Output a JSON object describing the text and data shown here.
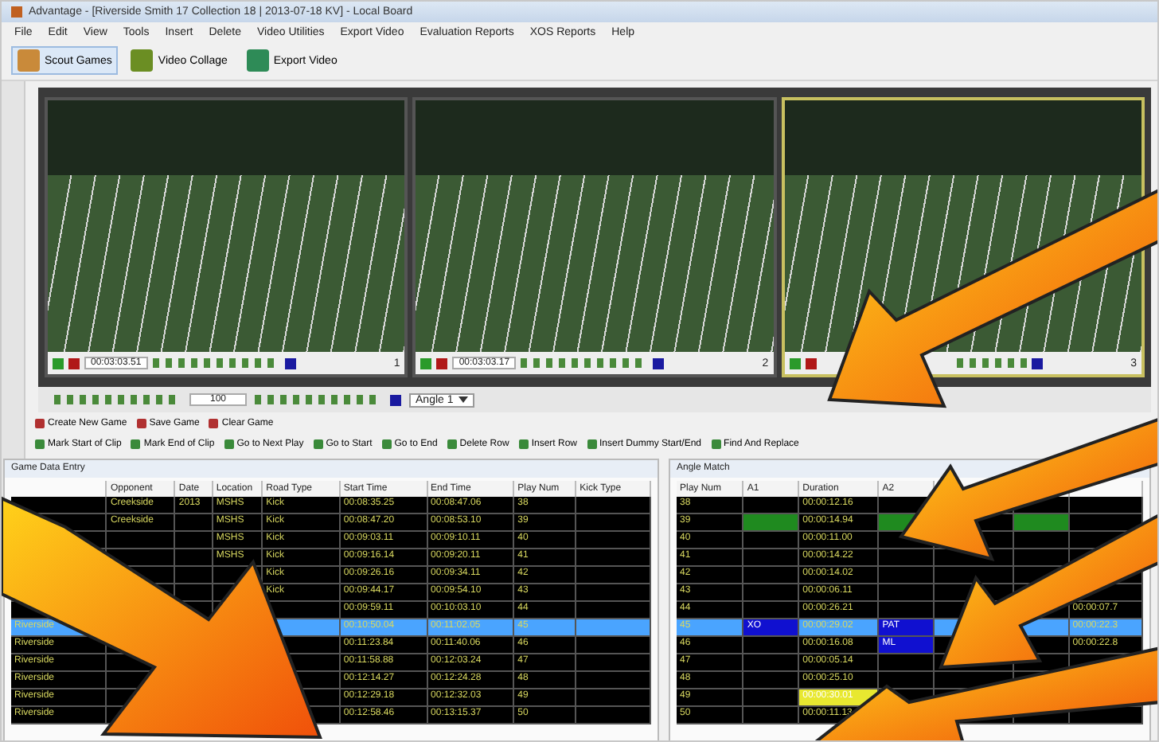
{
  "window": {
    "title": "Advantage - [Riverside Smith 17 Collection 18 | 2013-07-18 KV] - Local Board"
  },
  "menu": [
    "File",
    "Edit",
    "View",
    "Tools",
    "Insert",
    "Delete",
    "Video Utilities",
    "Export Video",
    "Evaluation Reports",
    "XOS Reports",
    "Help"
  ],
  "toolbar": [
    {
      "label": "Scout Games",
      "selected": true
    },
    {
      "label": "Video Collage",
      "selected": false
    },
    {
      "label": "Export Video",
      "selected": false
    }
  ],
  "videos": [
    {
      "timecode": "00:03:03.51",
      "angle": "1",
      "selected": false
    },
    {
      "timecode": "00:03:03.17",
      "angle": "2",
      "selected": false
    },
    {
      "angle": "3",
      "selected": true
    }
  ],
  "playback": {
    "speed": "100",
    "angle": "Angle 1"
  },
  "game_actions": [
    "Create New Game",
    "Save Game",
    "Clear Game"
  ],
  "clip_actions": [
    "Mark Start of Clip",
    "Mark End of Clip",
    "Go to Next Play",
    "Go to Start",
    "Go to End",
    "Delete Row",
    "Insert Row",
    "Insert Dummy Start/End",
    "Find And Replace"
  ],
  "game_table": {
    "title": "Game Data Entry",
    "columns": [
      {},
      {
        "label": "Opponent"
      },
      {
        "label": "Date"
      },
      {
        "label": "Location"
      },
      {
        "label": "Road Type"
      },
      {
        "label": "Start Time"
      },
      {
        "label": "End Time"
      },
      {
        "label": "Play Num"
      },
      {
        "label": "Kick Type"
      }
    ],
    "rows": [
      {
        "selected": false,
        "cells": [
          {},
          {
            "text": "Creekside"
          },
          {
            "text": "2013"
          },
          {
            "text": "MSHS"
          },
          {
            "text": "Kick"
          },
          {
            "text": "00:08:35.25"
          },
          {
            "text": "00:08:47.06"
          },
          {
            "text": "38"
          },
          {}
        ]
      },
      {
        "selected": false,
        "cells": [
          {},
          {
            "text": "Creekside"
          },
          {},
          {
            "text": "MSHS"
          },
          {
            "text": "Kick"
          },
          {
            "text": "00:08:47.20"
          },
          {
            "text": "00:08:53.10"
          },
          {
            "text": "39"
          },
          {}
        ]
      },
      {
        "selected": false,
        "cells": [
          {},
          {},
          {},
          {
            "text": "MSHS"
          },
          {
            "text": "Kick"
          },
          {
            "text": "00:09:03.11"
          },
          {
            "text": "00:09:10.11"
          },
          {
            "text": "40"
          },
          {}
        ]
      },
      {
        "selected": false,
        "cells": [
          {},
          {},
          {},
          {
            "text": "MSHS"
          },
          {
            "text": "Kick"
          },
          {
            "text": "00:09:16.14"
          },
          {
            "text": "00:09:20.11"
          },
          {
            "text": "41"
          },
          {}
        ]
      },
      {
        "selected": false,
        "cells": [
          {},
          {},
          {},
          {},
          {
            "text": "Kick"
          },
          {
            "text": "00:09:26.16"
          },
          {
            "text": "00:09:34.11"
          },
          {
            "text": "42"
          },
          {}
        ]
      },
      {
        "selected": false,
        "cells": [
          {},
          {},
          {},
          {},
          {
            "text": "Kick"
          },
          {
            "text": "00:09:44.17"
          },
          {
            "text": "00:09:54.10"
          },
          {
            "text": "43"
          },
          {}
        ]
      },
      {
        "selected": false,
        "cells": [
          {},
          {},
          {},
          {},
          {},
          {
            "text": "00:09:59.11"
          },
          {
            "text": "00:10:03.10"
          },
          {
            "text": "44"
          },
          {}
        ]
      },
      {
        "selected": true,
        "cells": [
          {
            "text": "Riverside"
          },
          {},
          {},
          {},
          {},
          {
            "text": "00:10:50.04"
          },
          {
            "text": "00:11:02.05"
          },
          {
            "text": "45"
          },
          {}
        ]
      },
      {
        "selected": false,
        "cells": [
          {
            "text": "Riverside"
          },
          {},
          {},
          {},
          {},
          {
            "text": "00:11:23.84"
          },
          {
            "text": "00:11:40.06"
          },
          {
            "text": "46"
          },
          {}
        ]
      },
      {
        "selected": false,
        "cells": [
          {
            "text": "Riverside"
          },
          {},
          {},
          {},
          {},
          {
            "text": "00:11:58.88"
          },
          {
            "text": "00:12:03.24"
          },
          {
            "text": "47"
          },
          {}
        ]
      },
      {
        "selected": false,
        "cells": [
          {
            "text": "Riverside"
          },
          {},
          {},
          {},
          {},
          {
            "text": "00:12:14.27"
          },
          {
            "text": "00:12:24.28"
          },
          {
            "text": "48"
          },
          {}
        ]
      },
      {
        "selected": false,
        "cells": [
          {
            "text": "Riverside"
          },
          {},
          {},
          {},
          {},
          {
            "text": "00:12:29.18"
          },
          {
            "text": "00:12:32.03"
          },
          {
            "text": "49"
          },
          {}
        ]
      },
      {
        "selected": false,
        "cells": [
          {
            "text": "Riverside"
          },
          {},
          {},
          {},
          {},
          {
            "text": "00:12:58.46"
          },
          {
            "text": "00:13:15.37"
          },
          {
            "text": "50"
          },
          {}
        ]
      }
    ]
  },
  "angle_table": {
    "title": "Angle Match",
    "columns": [
      {
        "label": "Play Num"
      },
      {
        "label": "A1"
      },
      {
        "label": "Duration"
      },
      {
        "label": "A2"
      },
      {},
      {},
      {}
    ],
    "rows": [
      {
        "selected": false,
        "cells": [
          {
            "text": "38"
          },
          {},
          {
            "text": "00:00:12.16"
          },
          {},
          {},
          {},
          {}
        ]
      },
      {
        "selected": false,
        "cells": [
          {
            "text": "39"
          },
          {
            "color": "#1f8a1f"
          },
          {
            "text": "00:00:14.94"
          },
          {
            "color": "#1f8a1f"
          },
          {},
          {
            "color": "#1f8a1f"
          },
          {}
        ]
      },
      {
        "selected": false,
        "cells": [
          {
            "text": "40"
          },
          {},
          {
            "text": "00:00:11.00"
          },
          {},
          {},
          {},
          {}
        ]
      },
      {
        "selected": false,
        "cells": [
          {
            "text": "41"
          },
          {},
          {
            "text": "00:00:14.22"
          },
          {},
          {},
          {},
          {}
        ]
      },
      {
        "selected": false,
        "cells": [
          {
            "text": "42"
          },
          {},
          {
            "text": "00:00:14.02"
          },
          {},
          {},
          {},
          {}
        ]
      },
      {
        "selected": false,
        "cells": [
          {
            "text": "43"
          },
          {},
          {
            "text": "00:00:06.11"
          },
          {},
          {},
          {},
          {}
        ]
      },
      {
        "selected": false,
        "cells": [
          {
            "text": "44"
          },
          {},
          {
            "text": "00:00:26.21"
          },
          {},
          {},
          {},
          {
            "text": "00:00:07.7"
          }
        ]
      },
      {
        "selected": true,
        "cells": [
          {
            "text": "45"
          },
          {
            "text": "XO",
            "color": "#1010d0"
          },
          {
            "text": "00:00:29.02"
          },
          {
            "text": "PAT",
            "color": "#1010d0"
          },
          {},
          {},
          {
            "text": "00:00:22.3"
          }
        ]
      },
      {
        "selected": false,
        "cells": [
          {
            "text": "46"
          },
          {},
          {
            "text": "00:00:16.08"
          },
          {
            "text": "ML",
            "color": "#1010d0"
          },
          {},
          {},
          {
            "text": "00:00:22.8"
          }
        ]
      },
      {
        "selected": false,
        "cells": [
          {
            "text": "47"
          },
          {},
          {
            "text": "00:00:05.14"
          },
          {},
          {},
          {},
          {}
        ]
      },
      {
        "selected": false,
        "cells": [
          {
            "text": "48"
          },
          {},
          {
            "text": "00:00:25.10"
          },
          {},
          {},
          {},
          {}
        ]
      },
      {
        "selected": false,
        "cells": [
          {
            "text": "49"
          },
          {},
          {
            "text": "00:00:30.01",
            "color": "#e8e830"
          },
          {},
          {},
          {},
          {}
        ]
      },
      {
        "selected": false,
        "cells": [
          {
            "text": "50"
          },
          {},
          {
            "text": "00:00:11.13"
          },
          {},
          {},
          {},
          {}
        ]
      }
    ]
  }
}
